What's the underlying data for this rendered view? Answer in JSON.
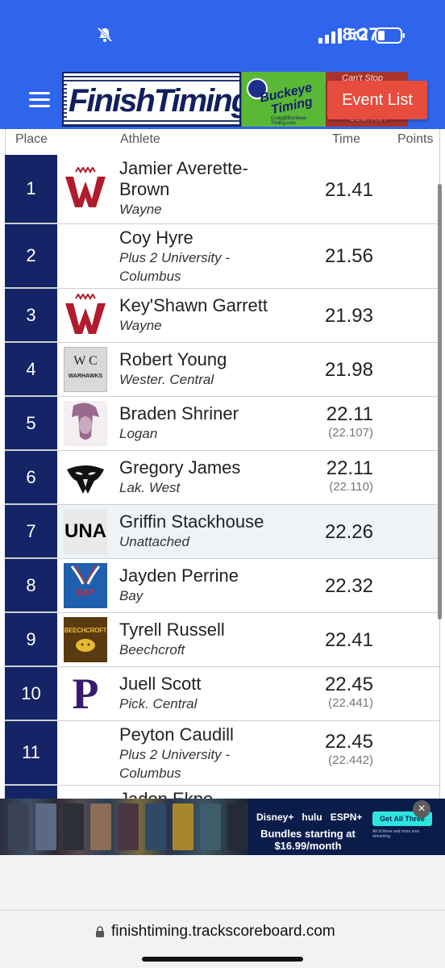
{
  "status": {
    "time": "8:27",
    "network": "5G",
    "icons": [
      "bell-muted-icon",
      "signal-icon",
      "battery-icon"
    ]
  },
  "header": {
    "menu_icon": "hamburger-icon",
    "logos": [
      "FinishTiming",
      "Buckeye Timing",
      "Craig@Buckeye-Timing.com",
      "Can't Stop",
      "COMPANY"
    ],
    "event_button": "Event List"
  },
  "columns": {
    "place": "Place",
    "athlete": "Athlete",
    "time": "Time",
    "points": "Points"
  },
  "results": [
    {
      "place": "1",
      "name": "Jamier Averette-Brown",
      "name_l1": "Jamier Averette-",
      "name_l2": "Brown",
      "team": "Wayne",
      "team_l2": "",
      "time": "21.41",
      "precise": "",
      "logo": "wayne-w-logo"
    },
    {
      "place": "2",
      "name": "Coy Hyre",
      "name_l1": "Coy Hyre",
      "name_l2": "",
      "team": "Plus 2 University -",
      "team_l2": "Columbus",
      "time": "21.56",
      "precise": "",
      "logo": ""
    },
    {
      "place": "3",
      "name": "Key'Shawn Garrett",
      "name_l1": "Key'Shawn Garrett",
      "name_l2": "",
      "team": "Wayne",
      "team_l2": "",
      "time": "21.93",
      "precise": "",
      "logo": "wayne-w-logo"
    },
    {
      "place": "4",
      "name": "Robert Young",
      "name_l1": "Robert Young",
      "name_l2": "",
      "team": "Wester. Central",
      "team_l2": "",
      "time": "21.98",
      "precise": "",
      "logo": "warhawks-logo",
      "logo_text": "WARHAWKS"
    },
    {
      "place": "5",
      "name": "Braden Shriner",
      "name_l1": "Braden Shriner",
      "name_l2": "",
      "team": "Logan",
      "team_l2": "",
      "time": "22.11",
      "precise": "(22.107)",
      "logo": "logan-chief-logo"
    },
    {
      "place": "6",
      "name": "Gregory James",
      "name_l1": "Gregory James",
      "name_l2": "",
      "team": "Lak. West",
      "team_l2": "",
      "time": "22.11",
      "precise": "(22.110)",
      "logo": "eagle-logo"
    },
    {
      "place": "7",
      "name": "Griffin Stackhouse",
      "name_l1": "Griffin Stackhouse",
      "name_l2": "",
      "team": "Unattached",
      "team_l2": "",
      "time": "22.26",
      "precise": "",
      "logo": "una-logo",
      "logo_text": "UNA"
    },
    {
      "place": "8",
      "name": "Jayden Perrine",
      "name_l1": "Jayden Perrine",
      "name_l2": "",
      "team": "Bay",
      "team_l2": "",
      "time": "22.32",
      "precise": "",
      "logo": "bay-track-logo",
      "logo_text": "BAY"
    },
    {
      "place": "9",
      "name": "Tyrell Russell",
      "name_l1": "Tyrell Russell",
      "name_l2": "",
      "team": "Beechcroft",
      "team_l2": "",
      "time": "22.41",
      "precise": "",
      "logo": "beechcroft-logo",
      "logo_text": "BEECHCROFT"
    },
    {
      "place": "10",
      "name": "Juell Scott",
      "name_l1": "Juell Scott",
      "name_l2": "",
      "team": "Pick. Central",
      "team_l2": "",
      "time": "22.45",
      "precise": "(22.441)",
      "logo": "pickerington-p-logo",
      "logo_text": "P"
    },
    {
      "place": "11",
      "name": "Peyton Caudill",
      "name_l1": "Peyton Caudill",
      "name_l2": "",
      "team": "Plus 2 University -",
      "team_l2": "Columbus",
      "time": "22.45",
      "precise": "(22.442)",
      "logo": ""
    },
    {
      "place": "",
      "name": "Jadon Ekpo",
      "name_l1": "Jadon Ekpo",
      "name_l2": "",
      "team": "",
      "team_l2": "",
      "time": "",
      "precise": "",
      "logo": ""
    }
  ],
  "ad": {
    "brands": [
      "Disney+",
      "hulu",
      "ESPN+"
    ],
    "headline": "Bundles starting at",
    "price": "$16.99/month",
    "cta": "Get All Three",
    "fine_print": "All of these and more now streaming.",
    "close": "×"
  },
  "browser": {
    "url": "finishtiming.trackscoreboard.com"
  },
  "colors": {
    "header_blue": "#2f64ec",
    "place_navy": "#142466",
    "event_button_red": "#e74c3c"
  }
}
